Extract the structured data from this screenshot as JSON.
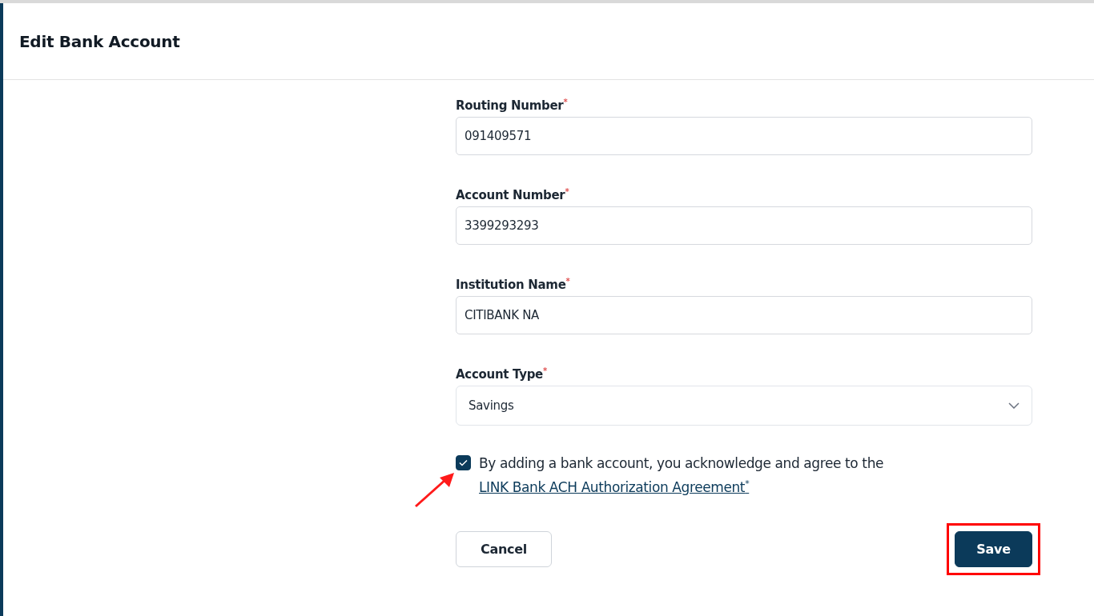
{
  "header": {
    "title": "Edit Bank Account"
  },
  "fields": [
    {
      "kind": "text",
      "label": "Routing Number",
      "required_mark": "*",
      "value": "091409571"
    },
    {
      "kind": "text",
      "label": "Account Number",
      "required_mark": "*",
      "value": "3399293293"
    },
    {
      "kind": "text",
      "label": "Institution Name",
      "required_mark": "*",
      "value": "CITIBANK NA"
    },
    {
      "kind": "select",
      "label": "Account Type",
      "required_mark": "*",
      "value": "Savings"
    }
  ],
  "agreement": {
    "checked": true,
    "text": "By adding a bank account, you acknowledge and agree to the",
    "link": "LINK Bank ACH Authorization Agreement$^{*}$"
  },
  "buttons": [
    {
      "kind": "secondary",
      "label": "Cancel"
    },
    {
      "kind": "primary",
      "label": "Save"
    }
  ],
  "annotations": {
    "arrow_to_checkbox": true,
    "highlight_save": true
  }
}
